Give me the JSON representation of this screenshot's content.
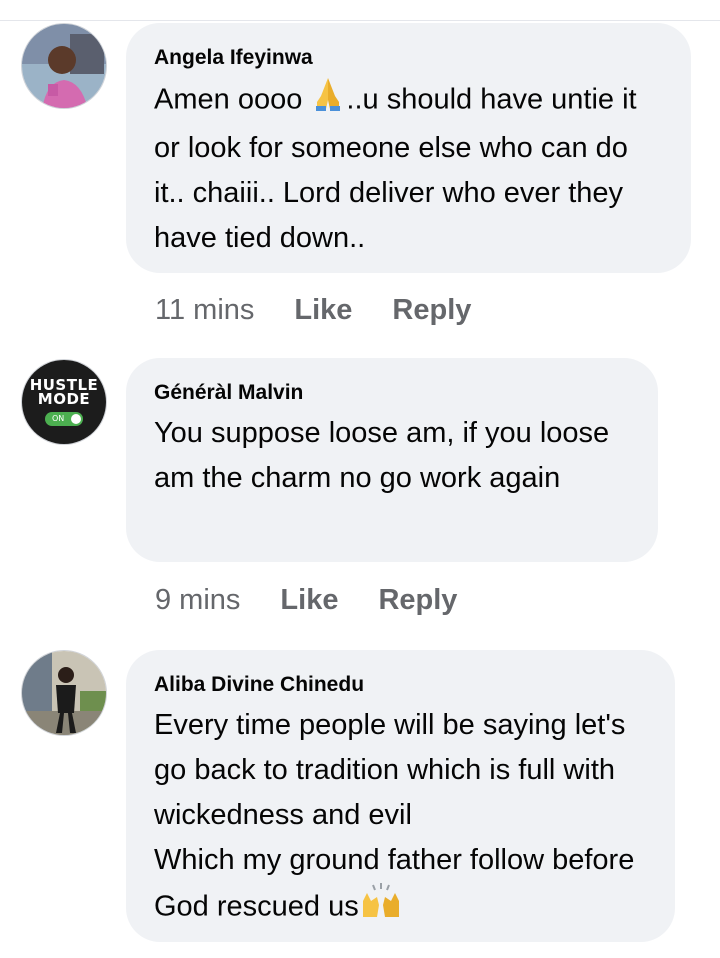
{
  "comments": [
    {
      "author": "Angela Ifeyinwa",
      "text_before_emoji": "Amen oooo ",
      "emoji": "folded-hands-emoji",
      "text_after_emoji": "..u should have untie it or look for someone else who can do it.. chaiii.. Lord deliver who ever they have tied down..",
      "time": "11 mins",
      "like_label": "Like",
      "reply_label": "Reply"
    },
    {
      "author": "Généràl Malvin",
      "avatar_text_line1": "HUSTLE",
      "avatar_text_line2": "MODE",
      "avatar_switch_label": "ON",
      "text": "You suppose loose am, if you loose am the charm no go work again",
      "time": "9 mins",
      "like_label": "Like",
      "reply_label": "Reply"
    },
    {
      "author": "Aliba Divine Chinedu",
      "text_line1": "Every time people will be saying let's go back to tradition which is full with wickedness and evil",
      "text_line2": "Which my ground father follow before God rescued us",
      "emoji": "raising-hands-emoji"
    }
  ],
  "colors": {
    "bubble": "#f0f2f5",
    "meta_text": "#65676b",
    "body_text": "#050505"
  }
}
